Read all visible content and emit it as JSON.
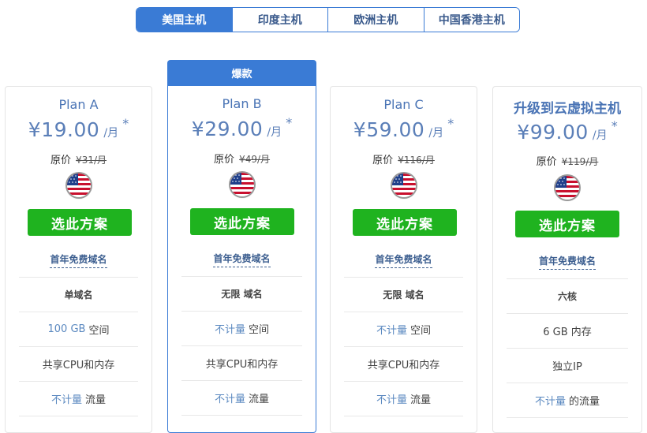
{
  "tabs": [
    {
      "label": "美国主机",
      "active": true
    },
    {
      "label": "印度主机",
      "active": false
    },
    {
      "label": "欧洲主机",
      "active": false
    },
    {
      "label": "中国香港主机",
      "active": false
    }
  ],
  "hot_label": "爆款",
  "plans": [
    {
      "name": "Plan A",
      "price": "¥19.00",
      "per": "/月",
      "star": "*",
      "orig_label": "原价",
      "orig_price": "¥31/月",
      "button": "选此方案",
      "features": {
        "domain_free": "首年免费域名",
        "domains": "单域名",
        "space_hl": "100 GB",
        "space_txt": "空间",
        "cpu": "共享CPU和内存",
        "traffic_hl": "不计量",
        "traffic_txt": "流量"
      }
    },
    {
      "name": "Plan B",
      "price": "¥29.00",
      "per": "/月",
      "star": "*",
      "orig_label": "原价",
      "orig_price": "¥49/月",
      "button": "选此方案",
      "features": {
        "domain_free": "首年免费域名",
        "domains": "无限 域名",
        "space_hl": "不计量",
        "space_txt": "空间",
        "cpu": "共享CPU和内存",
        "traffic_hl": "不计量",
        "traffic_txt": "流量"
      }
    },
    {
      "name": "Plan C",
      "price": "¥59.00",
      "per": "/月",
      "star": "*",
      "orig_label": "原价",
      "orig_price": "¥116/月",
      "button": "选此方案",
      "features": {
        "domain_free": "首年免费域名",
        "domains": "无限 域名",
        "space_hl": "不计量",
        "space_txt": "空间",
        "cpu": "共享CPU和内存",
        "traffic_hl": "不计量",
        "traffic_txt": "流量"
      }
    },
    {
      "name": "升级到云虚拟主机",
      "price": "¥99.00",
      "per": "/月",
      "star": "*",
      "orig_label": "原价",
      "orig_price": "¥119/月",
      "button": "选此方案",
      "features": {
        "domain_free": "首年免费域名",
        "cores": "六核",
        "memory": "6 GB 内存",
        "ip": "独立IP",
        "traffic_hl": "不计量",
        "traffic_txt": "的流量"
      }
    }
  ],
  "colors": {
    "accent": "#3a7bd5",
    "button": "#1fb31f",
    "price": "#5b7fb8"
  }
}
